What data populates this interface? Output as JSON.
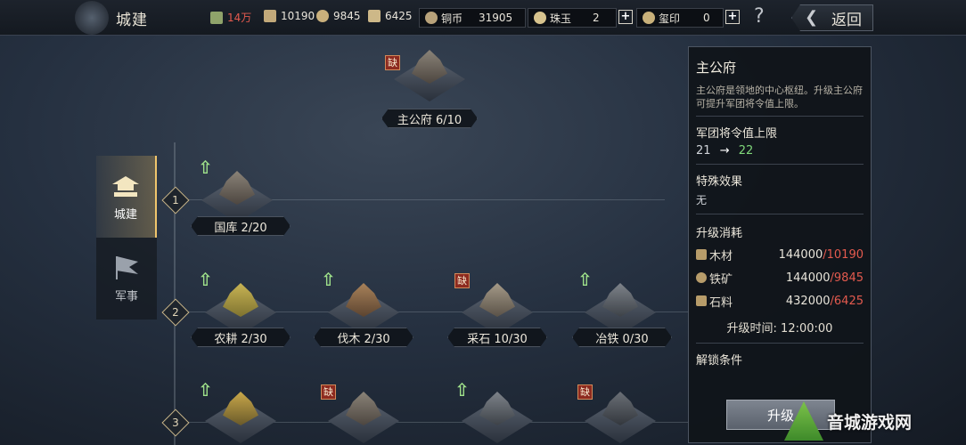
{
  "header": {
    "title": "城建",
    "resources": [
      {
        "icon": "leaf-icon",
        "value": "14万",
        "color": "#e35a4e"
      },
      {
        "icon": "wood-icon",
        "value": "10190",
        "color": "#e8e4da"
      },
      {
        "icon": "iron-ore-icon",
        "value": "9845",
        "color": "#e8e4da"
      },
      {
        "icon": "stone-icon",
        "value": "6425",
        "color": "#e8e4da"
      }
    ],
    "copper": {
      "label": "铜币",
      "value": "31905"
    },
    "pearl": {
      "label": "珠玉",
      "value": "2"
    },
    "seal": {
      "label": "玺印",
      "value": "0"
    },
    "plus": "+",
    "help": "?",
    "back_label": "返回"
  },
  "sidebar": {
    "items": [
      {
        "label": "城建",
        "active": true
      },
      {
        "label": "军事",
        "active": false
      }
    ]
  },
  "tree": {
    "main": {
      "label": "主公府 6/10",
      "missing": "缺"
    },
    "levels": [
      "1",
      "2",
      "3"
    ],
    "row1": [
      {
        "label": "国库 2/20"
      }
    ],
    "row2": [
      {
        "label": "农耕 2/30"
      },
      {
        "label": "伐木 2/30"
      },
      {
        "label": "采石 10/30",
        "missing": "缺"
      },
      {
        "label": "冶铁 0/30"
      }
    ],
    "row3_missing": "缺"
  },
  "panel": {
    "title": "主公府",
    "description": "主公府是领地的中心枢纽。升级主公府可提升军团将令值上限。",
    "stat_heading": "军团将令值上限",
    "stat_from": "21",
    "stat_arrow": "→",
    "stat_to": "22",
    "effect_heading": "特殊效果",
    "effect_value": "无",
    "cost_heading": "升级消耗",
    "costs": [
      {
        "name": "木材",
        "required": "144000",
        "have": "10190"
      },
      {
        "name": "铁矿",
        "required": "144000",
        "have": "9845"
      },
      {
        "name": "石料",
        "required": "432000",
        "have": "6425"
      }
    ],
    "cost_sep": "/",
    "time_label": "升级时间: 12:00:00",
    "unlock_heading": "解锁条件",
    "upgrade_button": "升级"
  },
  "watermark": "音城游戏网"
}
